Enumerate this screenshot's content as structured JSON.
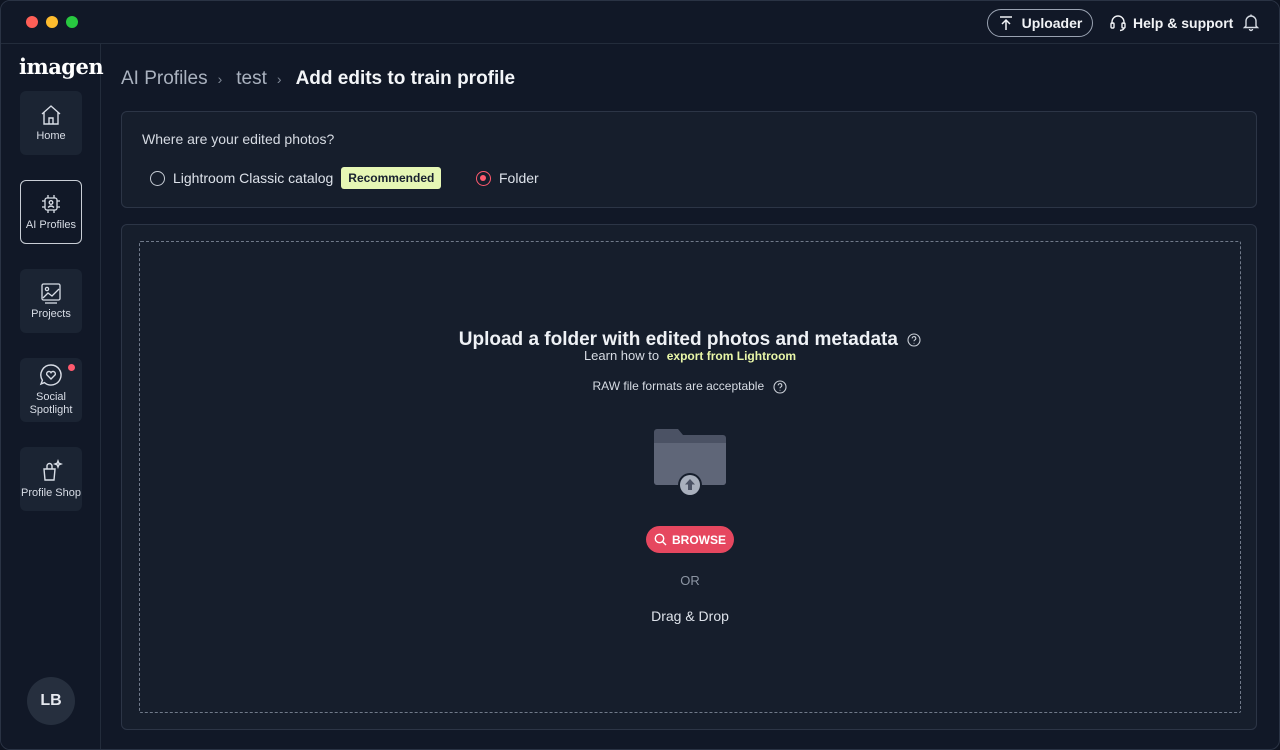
{
  "topbar": {
    "uploader_label": "Uploader",
    "help_label": "Help & support"
  },
  "sidebar": {
    "logo": "imagen",
    "items": [
      {
        "label": "Home",
        "icon": "home-icon"
      },
      {
        "label": "AI Profiles",
        "icon": "ai-chip-icon",
        "active": true
      },
      {
        "label": "Projects",
        "icon": "image-chart-icon"
      },
      {
        "label": "Social Spotlight",
        "icon": "heart-chat-icon",
        "notification": true
      },
      {
        "label": "Profile Shop",
        "icon": "shopping-sparkle-icon"
      }
    ],
    "avatar_initials": "LB"
  },
  "breadcrumb": {
    "items": [
      "AI Profiles",
      "test"
    ],
    "current": "Add edits to train profile"
  },
  "source": {
    "question": "Where are your edited photos?",
    "options": [
      {
        "label": "Lightroom Classic catalog",
        "badge": "Recommended",
        "selected": false
      },
      {
        "label": "Folder",
        "selected": true
      }
    ]
  },
  "upload": {
    "title": "Upload a folder with edited photos and metadata",
    "learn_prefix": "Learn how to",
    "learn_link": "export from Lightroom",
    "raw_note": "RAW file formats are acceptable",
    "browse_label": "BROWSE",
    "or_label": "OR",
    "drag_label": "Drag & Drop"
  },
  "colors": {
    "accent": "#e6475f",
    "badge_bg": "#e6f7b5",
    "link": "#e9f7a8",
    "background": "#111827",
    "card": "#161e2c"
  }
}
